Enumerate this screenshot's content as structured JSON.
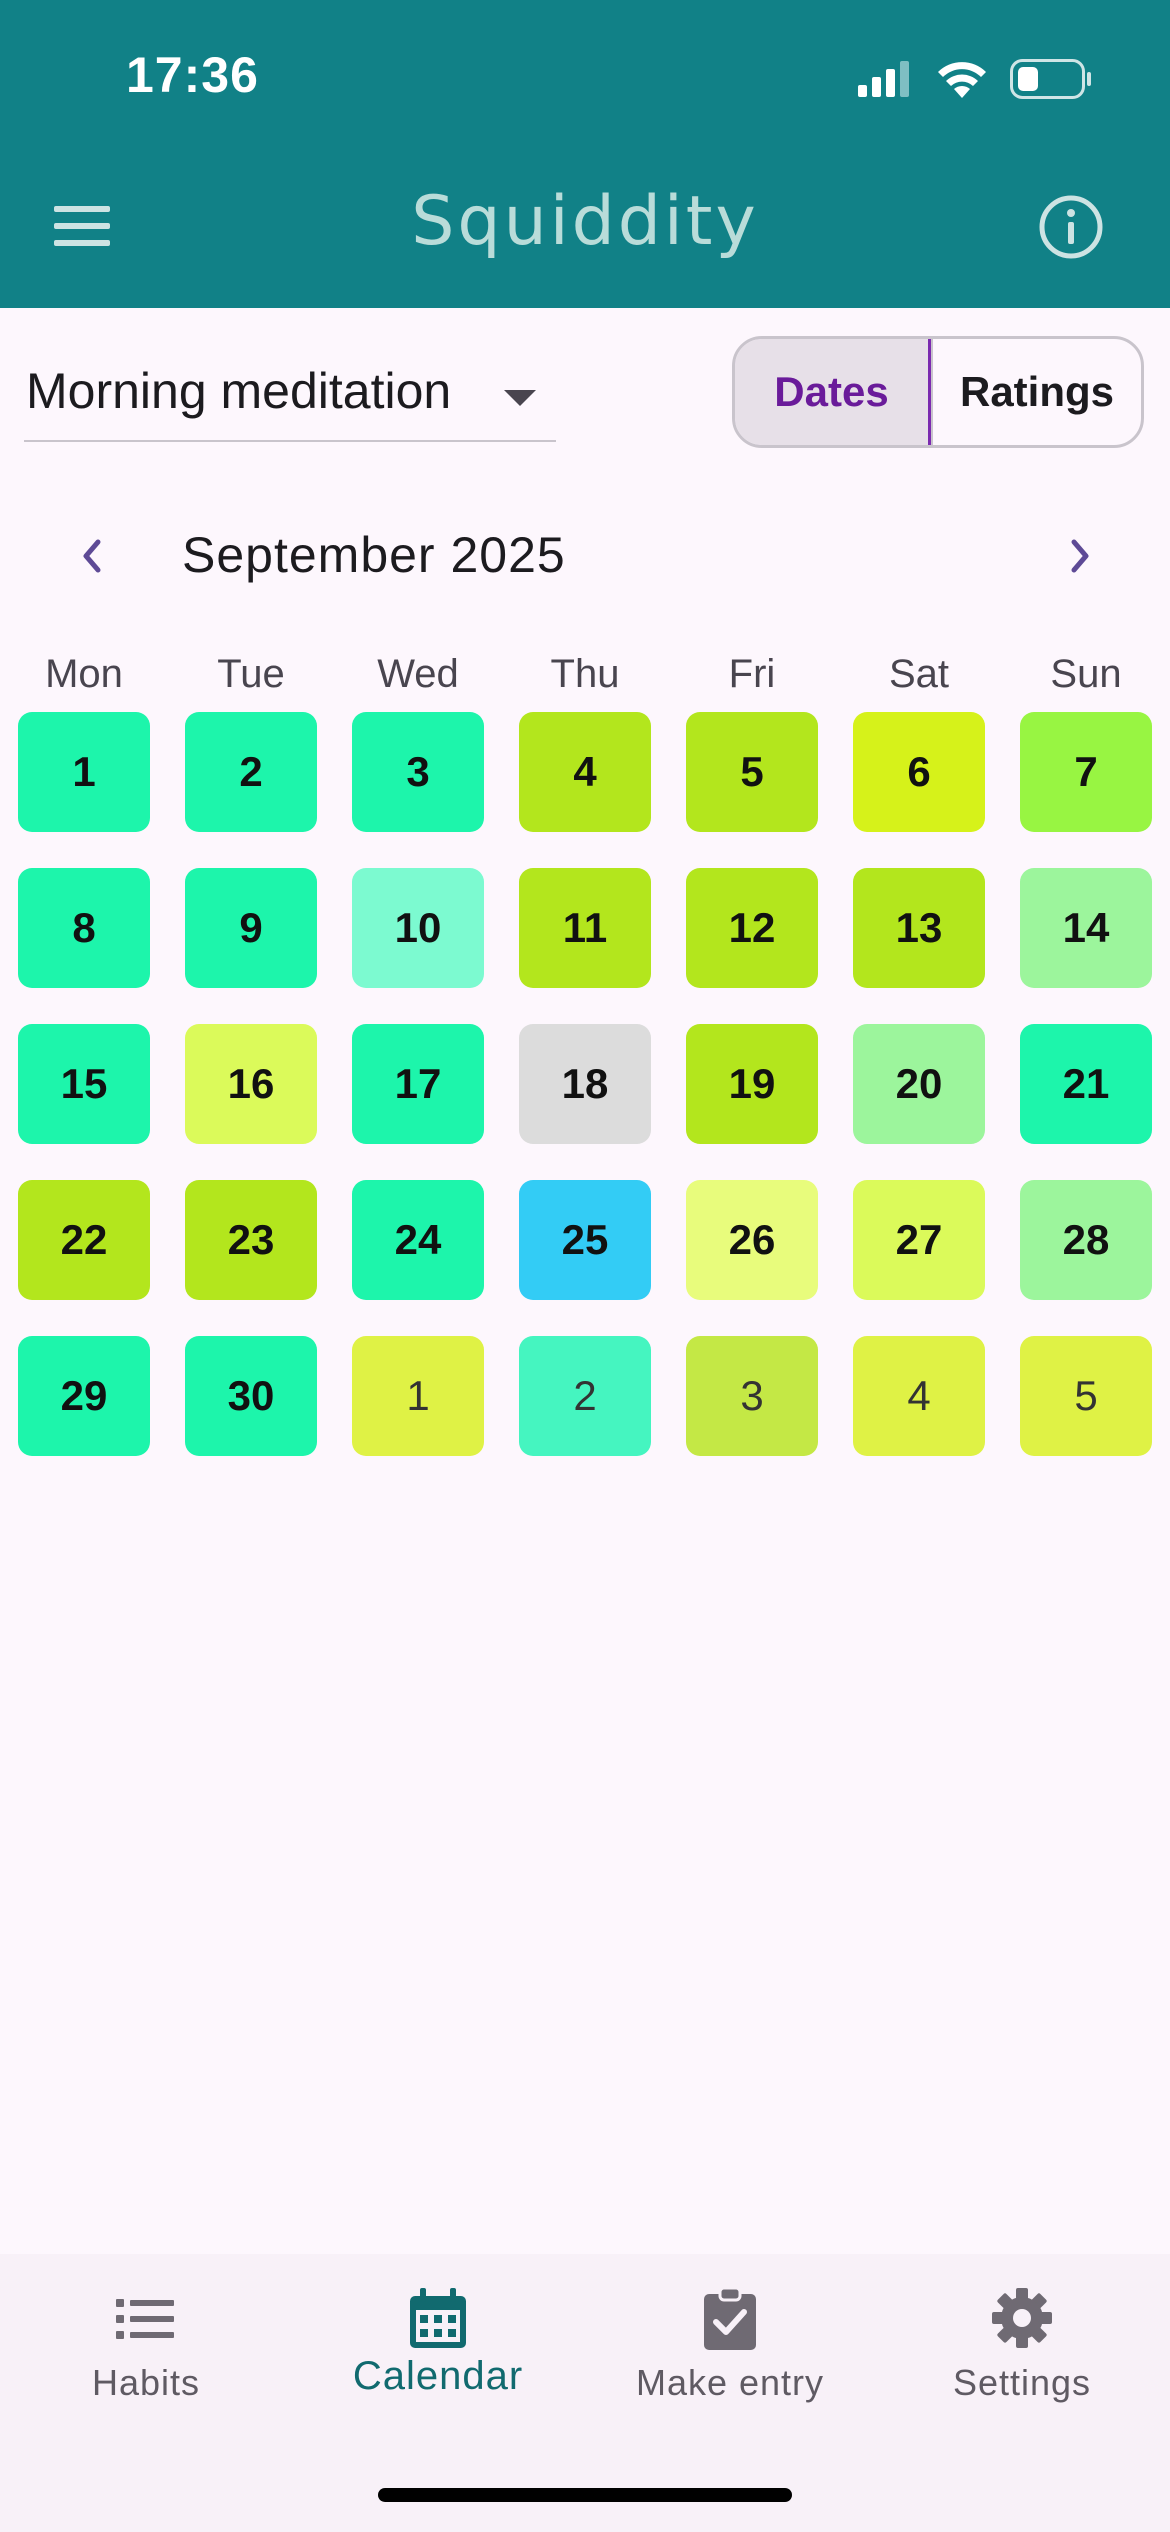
{
  "status_bar": {
    "time": "17:36"
  },
  "app_bar": {
    "title": "Squiddity"
  },
  "habit_selector": {
    "value": "Morning meditation"
  },
  "view_toggle": {
    "dates_label": "Dates",
    "ratings_label": "Ratings",
    "selected": "Dates"
  },
  "calendar": {
    "month_label": "September 2025",
    "weekdays": [
      "Mon",
      "Tue",
      "Wed",
      "Thu",
      "Fri",
      "Sat",
      "Sun"
    ],
    "weeks": [
      [
        {
          "day": "1",
          "in_month": true,
          "color": "#1df5ab"
        },
        {
          "day": "2",
          "in_month": true,
          "color": "#1df5ab"
        },
        {
          "day": "3",
          "in_month": true,
          "color": "#1df5ab"
        },
        {
          "day": "4",
          "in_month": true,
          "color": "#b3e61d"
        },
        {
          "day": "5",
          "in_month": true,
          "color": "#b3e61d"
        },
        {
          "day": "6",
          "in_month": true,
          "color": "#d6f21a"
        },
        {
          "day": "7",
          "in_month": true,
          "color": "#98f542"
        }
      ],
      [
        {
          "day": "8",
          "in_month": true,
          "color": "#1df5ab"
        },
        {
          "day": "9",
          "in_month": true,
          "color": "#1df5ab"
        },
        {
          "day": "10",
          "in_month": true,
          "color": "#7cfad0"
        },
        {
          "day": "11",
          "in_month": true,
          "color": "#b3e61d"
        },
        {
          "day": "12",
          "in_month": true,
          "color": "#b3e61d"
        },
        {
          "day": "13",
          "in_month": true,
          "color": "#b3e61d"
        },
        {
          "day": "14",
          "in_month": true,
          "color": "#9cf59c"
        }
      ],
      [
        {
          "day": "15",
          "in_month": true,
          "color": "#1df5ab"
        },
        {
          "day": "16",
          "in_month": true,
          "color": "#dbfa5a"
        },
        {
          "day": "17",
          "in_month": true,
          "color": "#1df5ab"
        },
        {
          "day": "18",
          "in_month": true,
          "color": "#dcdcdc"
        },
        {
          "day": "19",
          "in_month": true,
          "color": "#b3e61d"
        },
        {
          "day": "20",
          "in_month": true,
          "color": "#9cf59c"
        },
        {
          "day": "21",
          "in_month": true,
          "color": "#1df5ab"
        }
      ],
      [
        {
          "day": "22",
          "in_month": true,
          "color": "#b3e61d"
        },
        {
          "day": "23",
          "in_month": true,
          "color": "#b3e61d"
        },
        {
          "day": "24",
          "in_month": true,
          "color": "#1df5ab"
        },
        {
          "day": "25",
          "in_month": true,
          "color": "#33ccf5"
        },
        {
          "day": "26",
          "in_month": true,
          "color": "#e8fc7c"
        },
        {
          "day": "27",
          "in_month": true,
          "color": "#dbfa5a"
        },
        {
          "day": "28",
          "in_month": true,
          "color": "#9cf59c"
        }
      ],
      [
        {
          "day": "29",
          "in_month": true,
          "color": "#1df5ab"
        },
        {
          "day": "30",
          "in_month": true,
          "color": "#1df5ab"
        },
        {
          "day": "1",
          "in_month": false,
          "color": "#dff245"
        },
        {
          "day": "2",
          "in_month": false,
          "color": "#45f5c0"
        },
        {
          "day": "3",
          "in_month": false,
          "color": "#c4e845"
        },
        {
          "day": "4",
          "in_month": false,
          "color": "#dff245"
        },
        {
          "day": "5",
          "in_month": false,
          "color": "#dff245"
        }
      ]
    ]
  },
  "bottom_nav": {
    "items": [
      {
        "label": "Habits",
        "icon": "list-icon",
        "active": false
      },
      {
        "label": "Calendar",
        "icon": "calendar-icon",
        "active": true
      },
      {
        "label": "Make entry",
        "icon": "clipboard-check-icon",
        "active": false
      },
      {
        "label": "Settings",
        "icon": "gear-icon",
        "active": false
      }
    ]
  },
  "colors": {
    "app_bar": "#118187",
    "accent": "#6a1b9a",
    "active_nav": "#116a6f"
  }
}
